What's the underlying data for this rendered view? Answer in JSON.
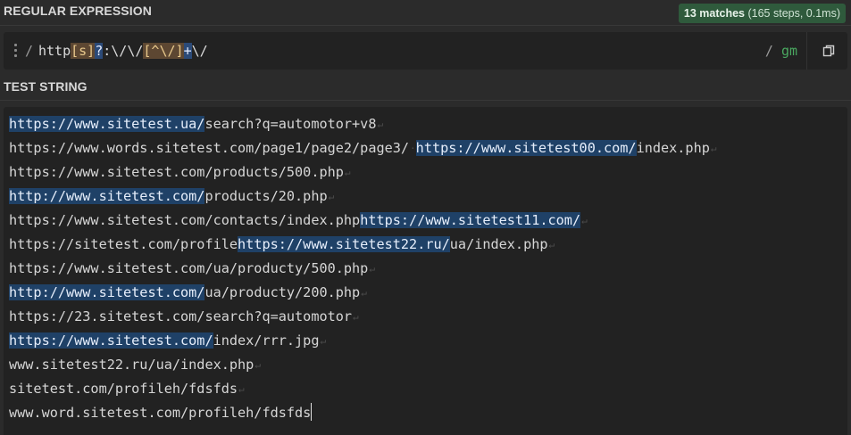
{
  "regex_section": {
    "title": "REGULAR EXPRESSION",
    "match_count": "13 matches",
    "match_details": "(165 steps, 0.1ms)",
    "delimiter_open": "/",
    "tokens": [
      {
        "text": "http",
        "type": "literal"
      },
      {
        "text": "[s]",
        "type": "class"
      },
      {
        "text": "?",
        "type": "quant"
      },
      {
        "text": ":\\/\\/",
        "type": "esc"
      },
      {
        "text": "[^\\/]",
        "type": "class"
      },
      {
        "text": "+",
        "type": "quant"
      },
      {
        "text": "\\/",
        "type": "esc"
      }
    ],
    "delimiter_close": "/",
    "flags": "gm",
    "copy_icon": "copy-icon",
    "drag_icon": "drag-handle-icon"
  },
  "test_section": {
    "title": "TEST STRING",
    "lines": [
      {
        "segments": [
          {
            "text": "https://www.sitetest.ua/",
            "match": true
          },
          {
            "text": "search?q=automotor+v8",
            "match": false
          }
        ],
        "newline": true
      },
      {
        "segments": [
          {
            "text": "https://www.words.sitetest.com/page1/page2/page3/",
            "match": false
          },
          {
            "text": "·",
            "match": false,
            "ws": true
          },
          {
            "text": "https://www.sitetest00.com/",
            "match": true
          },
          {
            "text": "index.php",
            "match": false
          }
        ],
        "newline": true
      },
      {
        "segments": [
          {
            "text": "https://www.sitetest.com/",
            "match": false
          },
          {
            "text": "products/500.php",
            "match": false
          }
        ],
        "newline": true
      },
      {
        "segments": [
          {
            "text": "http://www.sitetest.com/",
            "match": true
          },
          {
            "text": "products/20.php",
            "match": false
          }
        ],
        "newline": true
      },
      {
        "segments": [
          {
            "text": "https://www.sitetest.com/contacts/index.php",
            "match": false
          },
          {
            "text": "https://www.sitetest11.com/",
            "match": true
          }
        ],
        "newline": true
      },
      {
        "segments": [
          {
            "text": "https://sitetest.com/profile",
            "match": false
          },
          {
            "text": "https://www.sitetest22.ru/",
            "match": true
          },
          {
            "text": "ua/index.php",
            "match": false
          }
        ],
        "newline": true
      },
      {
        "segments": [
          {
            "text": "https://www.sitetest.com/",
            "match": false
          },
          {
            "text": "ua/producty/500.php",
            "match": false
          }
        ],
        "newline": true
      },
      {
        "segments": [
          {
            "text": "http://www.sitetest.com/",
            "match": true
          },
          {
            "text": "ua/producty/200.php",
            "match": false
          }
        ],
        "newline": true
      },
      {
        "segments": [
          {
            "text": "https://23.sitetest.com/",
            "match": false
          },
          {
            "text": "search?q=automotor",
            "match": false
          }
        ],
        "newline": true
      },
      {
        "segments": [
          {
            "text": "https://www.sitetest.com/",
            "match": true
          },
          {
            "text": "index/rrr.jpg",
            "match": false
          }
        ],
        "newline": true
      },
      {
        "segments": [
          {
            "text": "www.sitetest22.ru/ua/index.php",
            "match": false
          }
        ],
        "newline": true
      },
      {
        "segments": [
          {
            "text": "sitetest.com/profileh/fdsfds",
            "match": false
          }
        ],
        "newline": true
      },
      {
        "segments": [
          {
            "text": "www.word.sitetest.com/profileh/fdsfds",
            "match": false
          }
        ],
        "newline": false,
        "caret": true
      }
    ],
    "newline_symbol": "↵"
  }
}
